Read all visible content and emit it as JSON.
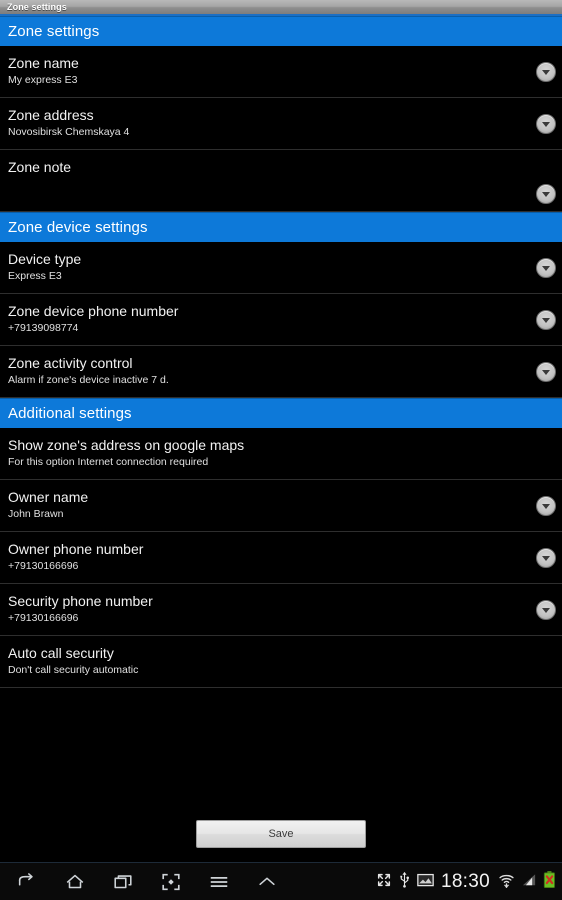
{
  "window": {
    "title": "Zone settings"
  },
  "colors": {
    "section_header_blue": "#0d79d9",
    "background": "#000000",
    "title_text": "#f2f2f2",
    "sub_text": "#e0e0e0",
    "save_button_face": "#e6e6e6",
    "battery_green": "#6bbf23",
    "battery_error_red": "#d03020"
  },
  "sections": [
    {
      "header": "Zone settings",
      "rows": [
        {
          "title": "Zone name",
          "sub": "My express E3",
          "chevron": true,
          "chevron_pos": "mid",
          "tall": false
        },
        {
          "title": "Zone address",
          "sub": "Novosibirsk Chemskaya 4",
          "chevron": true,
          "chevron_pos": "mid",
          "tall": false
        },
        {
          "title": "Zone note",
          "sub": "",
          "chevron": true,
          "chevron_pos": "low",
          "tall": true
        }
      ]
    },
    {
      "header": "Zone device settings",
      "rows": [
        {
          "title": "Device type",
          "sub": "Express E3",
          "chevron": true,
          "chevron_pos": "mid",
          "tall": false
        },
        {
          "title": "Zone device phone number",
          "sub": "+79139098774",
          "chevron": true,
          "chevron_pos": "mid",
          "tall": false
        },
        {
          "title": "Zone activity control",
          "sub": "Alarm if zone's device inactive 7 d.",
          "chevron": true,
          "chevron_pos": "mid",
          "tall": false
        }
      ]
    },
    {
      "header": "Additional settings",
      "rows": [
        {
          "title": "Show zone's address on google maps",
          "sub": "For this option Internet connection required",
          "chevron": false,
          "chevron_pos": "mid",
          "tall": false
        },
        {
          "title": "Owner name",
          "sub": "John Brawn",
          "chevron": true,
          "chevron_pos": "mid",
          "tall": false
        },
        {
          "title": "Owner phone number",
          "sub": "+79130166696",
          "chevron": true,
          "chevron_pos": "mid",
          "tall": false
        },
        {
          "title": "Security phone number",
          "sub": "+79130166696",
          "chevron": true,
          "chevron_pos": "mid",
          "tall": false
        },
        {
          "title": "Auto call security",
          "sub": "Don't call security automatic",
          "chevron": false,
          "chevron_pos": "mid",
          "tall": false
        }
      ]
    }
  ],
  "save": {
    "label": "Save"
  },
  "navbar": {
    "icons": [
      "back-icon",
      "home-icon",
      "recents-icon",
      "screenshot-icon",
      "menu-icon",
      "chevron-up-icon"
    ]
  },
  "statusbar": {
    "time": "18:30",
    "icons": [
      "fullscreen-expand-icon",
      "usb-icon",
      "picture-icon",
      "wifi-icon",
      "signal-icon",
      "battery-error-icon"
    ]
  }
}
